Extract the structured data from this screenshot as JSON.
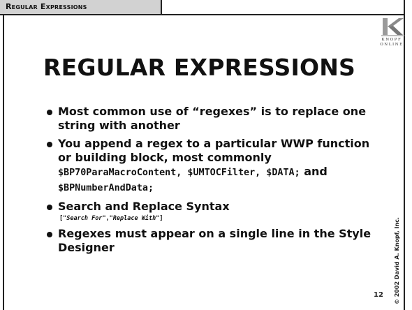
{
  "header": {
    "section": "Regular Expressions"
  },
  "logo": {
    "line1": "KNOPF",
    "line2": "ONLINE"
  },
  "slide": {
    "title": "REGULAR EXPRESSIONS",
    "bullets": {
      "b1": "Most common use of “regexes” is to replace one string with another",
      "b2_text": "You append a regex to a particular WWP function or building block, most commonly ",
      "b2_code1": "$BP70ParaMacroContent, $UMTOCFilter, $DATA;",
      "b2_and": " and ",
      "b2_code2": "$BPNumberAndData;",
      "b3": "Search and Replace Syntax",
      "b3_syntax_open": "[\"",
      "b3_syntax_search": "Search For",
      "b3_syntax_mid": "\",\"",
      "b3_syntax_replace": "Replace With",
      "b3_syntax_close": "\"]",
      "b4": "Regexes must appear on a single line in the Style Designer"
    }
  },
  "footer": {
    "page_number": "12",
    "copyright": "© 2002 David A. Knopf, Inc."
  }
}
